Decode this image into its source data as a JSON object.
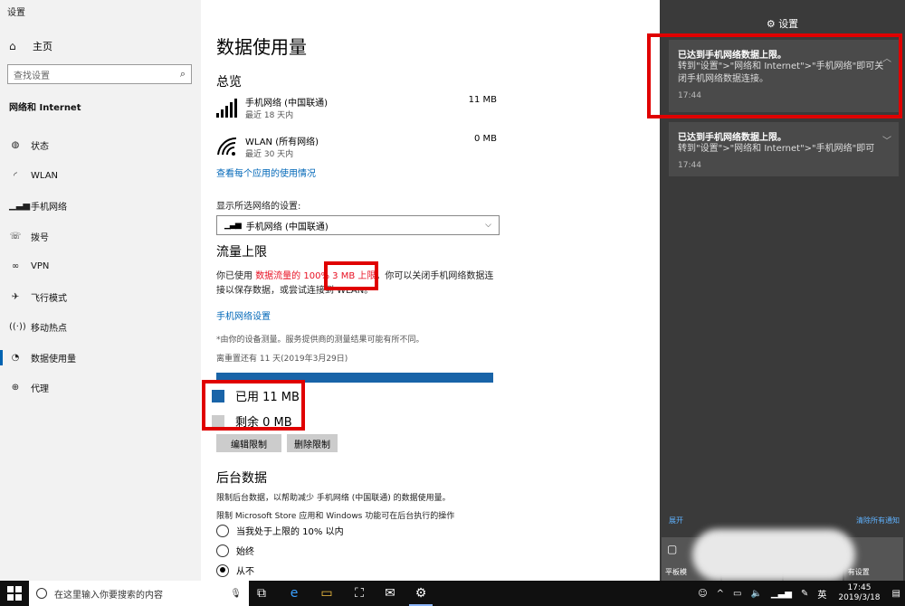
{
  "window": {
    "title": "设置"
  },
  "nav": {
    "home": "主页",
    "search_placeholder": "查找设置",
    "section": "网络和 Internet",
    "items": [
      {
        "label": "状态",
        "icon": "globe-icon"
      },
      {
        "label": "WLAN",
        "icon": "wifi-icon"
      },
      {
        "label": "手机网络",
        "icon": "signal-icon"
      },
      {
        "label": "拨号",
        "icon": "dialup-icon"
      },
      {
        "label": "VPN",
        "icon": "vpn-icon"
      },
      {
        "label": "飞行模式",
        "icon": "airplane-icon"
      },
      {
        "label": "移动热点",
        "icon": "hotspot-icon"
      },
      {
        "label": "数据使用量",
        "icon": "data-usage-icon"
      },
      {
        "label": "代理",
        "icon": "proxy-globe-icon"
      }
    ]
  },
  "main": {
    "title": "数据使用量",
    "overview_heading": "总览",
    "usage": [
      {
        "name": "手机网络 (中国联通)",
        "period": "最近 18 天内",
        "value": "11 MB"
      },
      {
        "name": "WLAN (所有网络)",
        "period": "最近 30 天内",
        "value": "0 MB"
      }
    ],
    "per_app_link": "查看每个应用的使用情况",
    "show_settings_label": "显示所选网络的设置:",
    "network_select": "手机网络 (中国联通)",
    "limit_heading": "流量上限",
    "limit_text_pre": "你已使用",
    "limit_text_red": "数据流量的 100%",
    "limit_text_red2": "3 MB 上限",
    "limit_text_post": "。你可以关闭手机网络数据连接以保存数据，或尝试连接到 WLAN。",
    "mobile_settings_link": "手机网络设置",
    "measure_note": "*由你的设备测量。服务提供商的测量结果可能有所不同。",
    "reset_note": "离重置还有 11 天(2019年3月29日)",
    "used_label": "已用 11 MB",
    "remaining_label": "剩余 0 MB",
    "used_fraction": 1.0,
    "edit_button": "编辑限制",
    "delete_button": "删除限制",
    "bg_heading": "后台数据",
    "bg_desc": "限制后台数据，以帮助减少 手机网络 (中国联通) 的数据使用量。",
    "bg_sub": "限制 Microsoft Store 应用和 Windows 功能可在后台执行的操作",
    "radios": [
      {
        "label": "当我处于上限的 10% 以内",
        "checked": false
      },
      {
        "label": "始终",
        "checked": false
      },
      {
        "label": "从不",
        "checked": true
      }
    ]
  },
  "action_center": {
    "header": "设置",
    "notifications": [
      {
        "title": "已达到手机网络数据上限。",
        "body": "转到\"设置\">\"网络和 Internet\">\"手机网络\"即可关闭手机网络数据连接。",
        "time": "17:44"
      },
      {
        "title": "已达到手机网络数据上限。",
        "body": "转到\"设置\">\"网络和 Internet\">\"手机网络\"即可",
        "time": "17:44"
      }
    ],
    "expand_link": "展开",
    "clear_link": "清除所有通知",
    "tiles": [
      {
        "label": "平板模",
        "icon": "tablet-icon"
      },
      {
        "label": "",
        "icon": ""
      },
      {
        "label": "",
        "icon": ""
      },
      {
        "label": "有设置",
        "icon": ""
      }
    ]
  },
  "taskbar": {
    "search_placeholder": "在这里输入你要搜索的内容",
    "ime": "英",
    "time": "17:45",
    "date": "2019/3/18"
  },
  "colors": {
    "accent": "#0063b1",
    "link": "#0067b8",
    "highlight": "#e00000",
    "bar": "#1964a8"
  }
}
